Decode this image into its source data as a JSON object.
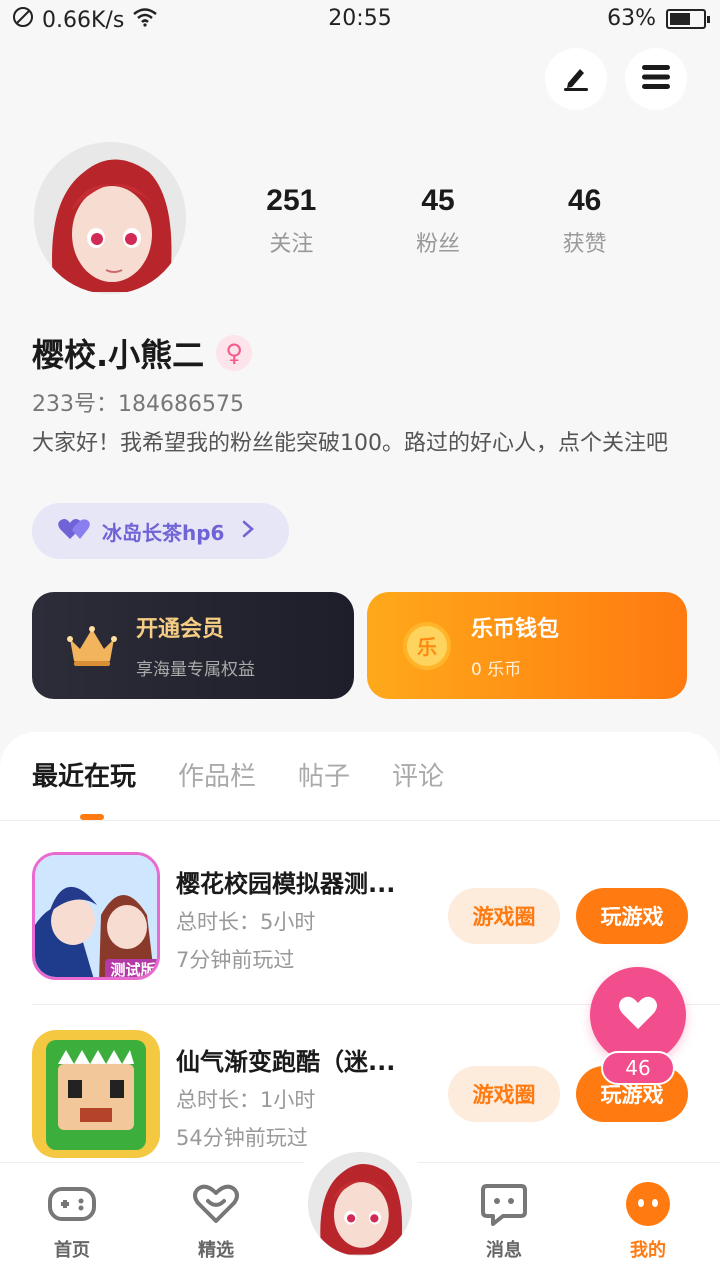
{
  "status_bar": {
    "network_speed": "0.66K/s",
    "time": "20:55",
    "battery": "63%",
    "battery_level": 0.63
  },
  "profile": {
    "stats": [
      {
        "value": "251",
        "label": "关注"
      },
      {
        "value": "45",
        "label": "粉丝"
      },
      {
        "value": "46",
        "label": "获赞"
      }
    ],
    "username": "樱校.小熊二",
    "gender_icon": "female-icon",
    "uid": "233号：184686575",
    "bio": "大家好！我希望我的粉丝能突破100。路过的好心人，点个关注吧",
    "tag": "冰岛长茶hp6"
  },
  "cards": {
    "vip": {
      "title": "开通会员",
      "subtitle": "享海量专属权益"
    },
    "wallet": {
      "title": "乐币钱包",
      "subtitle": "0 乐币",
      "coin_glyph": "乐"
    }
  },
  "tabs": [
    "最近在玩",
    "作品栏",
    "帖子",
    "评论"
  ],
  "games": [
    {
      "title": "樱花校园模拟器测...",
      "play_time": "总时长：5小时",
      "last_played": "7分钟前玩过",
      "circle_label": "游戏圈",
      "play_label": "玩游戏",
      "badge": "测试版"
    },
    {
      "title": "仙气渐变跑酷（迷...",
      "play_time": "总时长：1小时",
      "last_played": "54分钟前玩过",
      "circle_label": "游戏圈",
      "play_label": "玩游戏"
    }
  ],
  "like_fab": {
    "count": "46"
  },
  "bottom_nav": {
    "home": "首页",
    "featured": "精选",
    "messages": "消息",
    "mine": "我的"
  },
  "colors": {
    "accent": "#ff7a10",
    "pink": "#f24d8c",
    "purple": "#6f63d6"
  }
}
